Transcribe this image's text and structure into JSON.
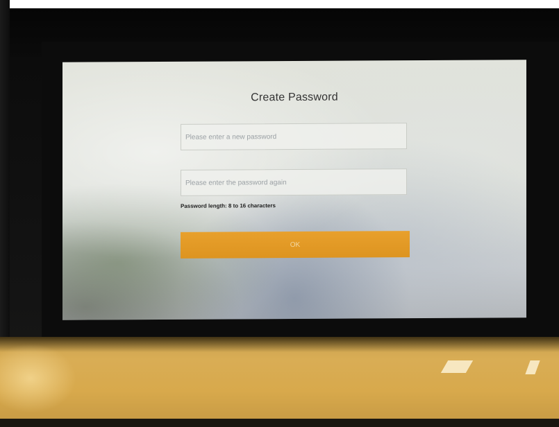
{
  "dialog": {
    "title": "Create Password",
    "new_password_placeholder": "Please enter a new password",
    "confirm_password_placeholder": "Please enter the password again",
    "hint": "Password length: 8 to 16 characters",
    "ok_label": "OK"
  },
  "colors": {
    "ok_button": "#e09a26",
    "screen_background": "#dcdfd8"
  }
}
